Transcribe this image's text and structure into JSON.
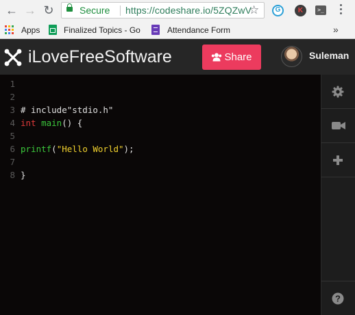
{
  "browser": {
    "secure_label": "Secure",
    "url": "https://codeshare.io/5ZQZwV",
    "extensions": [
      {
        "name": "grammarly-icon",
        "label": "G"
      },
      {
        "name": "k-extension-icon",
        "label": "K"
      },
      {
        "name": "terminal-extension-icon",
        "label": ">_"
      }
    ]
  },
  "bookmarks": {
    "apps_label": "Apps",
    "items": [
      {
        "label": "Finalized Topics - Goo"
      },
      {
        "label": "Attendance Form"
      }
    ]
  },
  "header": {
    "logo_text": "iLoveFreeSoftware",
    "share_label": "Share",
    "user_name": "Suleman"
  },
  "editor": {
    "lines": [
      {
        "num": "1",
        "tokens": []
      },
      {
        "num": "2",
        "tokens": []
      },
      {
        "num": "3",
        "tokens": [
          {
            "type": "pl",
            "text": "# include\"stdio.h\""
          }
        ]
      },
      {
        "num": "4",
        "tokens": [
          {
            "type": "kw",
            "text": "int"
          },
          {
            "type": "pl",
            "text": " "
          },
          {
            "type": "fn",
            "text": "main"
          },
          {
            "type": "pl",
            "text": "() {"
          }
        ]
      },
      {
        "num": "5",
        "tokens": []
      },
      {
        "num": "6",
        "tokens": [
          {
            "type": "fn",
            "text": "printf"
          },
          {
            "type": "pl",
            "text": "("
          },
          {
            "type": "str",
            "text": "\"Hello World\""
          },
          {
            "type": "pl",
            "text": ");"
          }
        ]
      },
      {
        "num": "7",
        "tokens": []
      },
      {
        "num": "8",
        "tokens": [
          {
            "type": "pl",
            "text": "}"
          }
        ]
      }
    ]
  },
  "sidebar": {
    "buttons": [
      {
        "name": "settings-gear-icon"
      },
      {
        "name": "video-camera-icon"
      },
      {
        "name": "add-plus-icon"
      },
      {
        "name": "help-question-icon"
      }
    ]
  },
  "colors": {
    "share_button": "#ec3b5e",
    "header_bg": "#262626",
    "editor_bg": "#0a0707",
    "keyword": "#e03a3a",
    "function": "#3cc83c",
    "string": "#f2d22e"
  }
}
